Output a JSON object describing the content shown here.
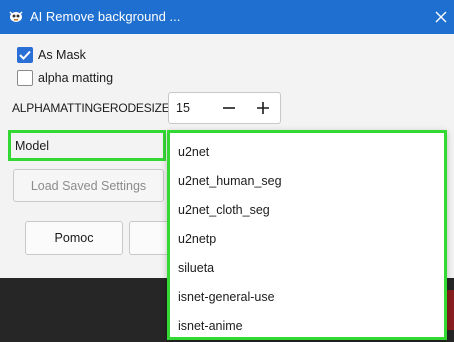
{
  "window": {
    "title": "AI Remove background ...",
    "accent_color": "#1e6fd0",
    "close_icon": "close-icon",
    "app_icon": "gimp-icon"
  },
  "options": {
    "as_mask": {
      "label": "As Mask",
      "checked": true
    },
    "alpha_matting": {
      "label": "alpha matting",
      "checked": false
    }
  },
  "alpha_matting_erode": {
    "label": "ALPHAMATTINGERODESIZE",
    "value": "15",
    "decrement_icon": "minus-icon",
    "increment_icon": "plus-icon"
  },
  "model": {
    "label": "Model",
    "options": [
      "u2net",
      "u2net_human_seg",
      "u2net_cloth_seg",
      "u2netp",
      "silueta",
      "isnet-general-use",
      "isnet-anime"
    ],
    "highlight_color": "#33d833"
  },
  "buttons": {
    "load_saved_settings": "Load Saved Settings",
    "help": "Pomoc"
  }
}
